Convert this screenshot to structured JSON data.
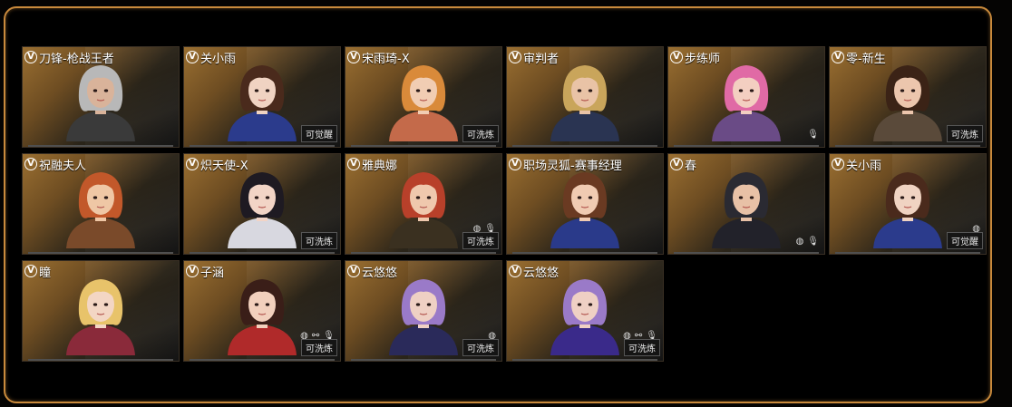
{
  "characters": [
    {
      "name": "刀锋-枪战王者",
      "badge": "",
      "features": [],
      "hair": "#b8b8b8",
      "outfit": "#3a3a3a",
      "skin": "#d9b39a"
    },
    {
      "name": "关小雨",
      "badge": "可觉醒",
      "features": [],
      "hair": "#4a2a1c",
      "outfit": "#2b3b8c",
      "skin": "#f0d3c2"
    },
    {
      "name": "宋雨琦-X",
      "badge": "可洗炼",
      "features": [],
      "hair": "#d98a3a",
      "outfit": "#c46a4a",
      "skin": "#f1cdb3"
    },
    {
      "name": "审判者",
      "badge": "",
      "features": [],
      "hair": "#c9a55b",
      "outfit": "#2a3452",
      "skin": "#e9c3a6"
    },
    {
      "name": "步练师",
      "badge": "",
      "features": [
        "mic-icon"
      ],
      "hair": "#e06aa5",
      "outfit": "#6a4b86",
      "skin": "#f3cfc1"
    },
    {
      "name": "零-新生",
      "badge": "可洗炼",
      "features": [],
      "hair": "#3b2316",
      "outfit": "#5a4a3a",
      "skin": "#ecc6ad"
    },
    {
      "name": "祝融夫人",
      "badge": "",
      "features": [],
      "hair": "#c2582a",
      "outfit": "#7a4a2a",
      "skin": "#efc7a5"
    },
    {
      "name": "炽天使-X",
      "badge": "可洗炼",
      "features": [],
      "hair": "#1e1a22",
      "outfit": "#d8d8e0",
      "skin": "#f2d4c6"
    },
    {
      "name": "雅典娜",
      "badge": "可洗炼",
      "features": [
        "voice-icon",
        "mic-icon"
      ],
      "hair": "#b8402a",
      "outfit": "#3a3020",
      "skin": "#efc8ad"
    },
    {
      "name": "职场灵狐-赛事经理",
      "badge": "",
      "features": [],
      "hair": "#6a3a22",
      "outfit": "#2a3a8a",
      "skin": "#f0cbb2"
    },
    {
      "name": "春",
      "badge": "",
      "features": [
        "voice-icon",
        "mic-icon"
      ],
      "hair": "#2a2a32",
      "outfit": "#22222a",
      "skin": "#e8c1a6"
    },
    {
      "name": "关小雨",
      "badge": "可觉醒",
      "features": [
        "voice-icon"
      ],
      "hair": "#4a2a1c",
      "outfit": "#2b3b8c",
      "skin": "#f0d3c2"
    },
    {
      "name": "瞳",
      "badge": "",
      "features": [],
      "hair": "#e8c36a",
      "outfit": "#8a2a3a",
      "skin": "#f3d6c4"
    },
    {
      "name": "子涵",
      "badge": "可洗炼",
      "features": [
        "voice-icon",
        "bone-icon",
        "mic-icon"
      ],
      "hair": "#3a1e18",
      "outfit": "#b02a2a",
      "skin": "#f2d0bd"
    },
    {
      "name": "云悠悠",
      "badge": "可洗炼",
      "features": [
        "voice-icon"
      ],
      "hair": "#9a7ac8",
      "outfit": "#2a2a5a",
      "skin": "#efd0c4"
    },
    {
      "name": "云悠悠",
      "badge": "可洗炼",
      "features": [
        "voice-icon",
        "bone-icon",
        "mic-icon"
      ],
      "hair": "#9a7ac8",
      "outfit": "#3a2a8a",
      "skin": "#efd0c4"
    }
  ],
  "vip_symbol": "V"
}
